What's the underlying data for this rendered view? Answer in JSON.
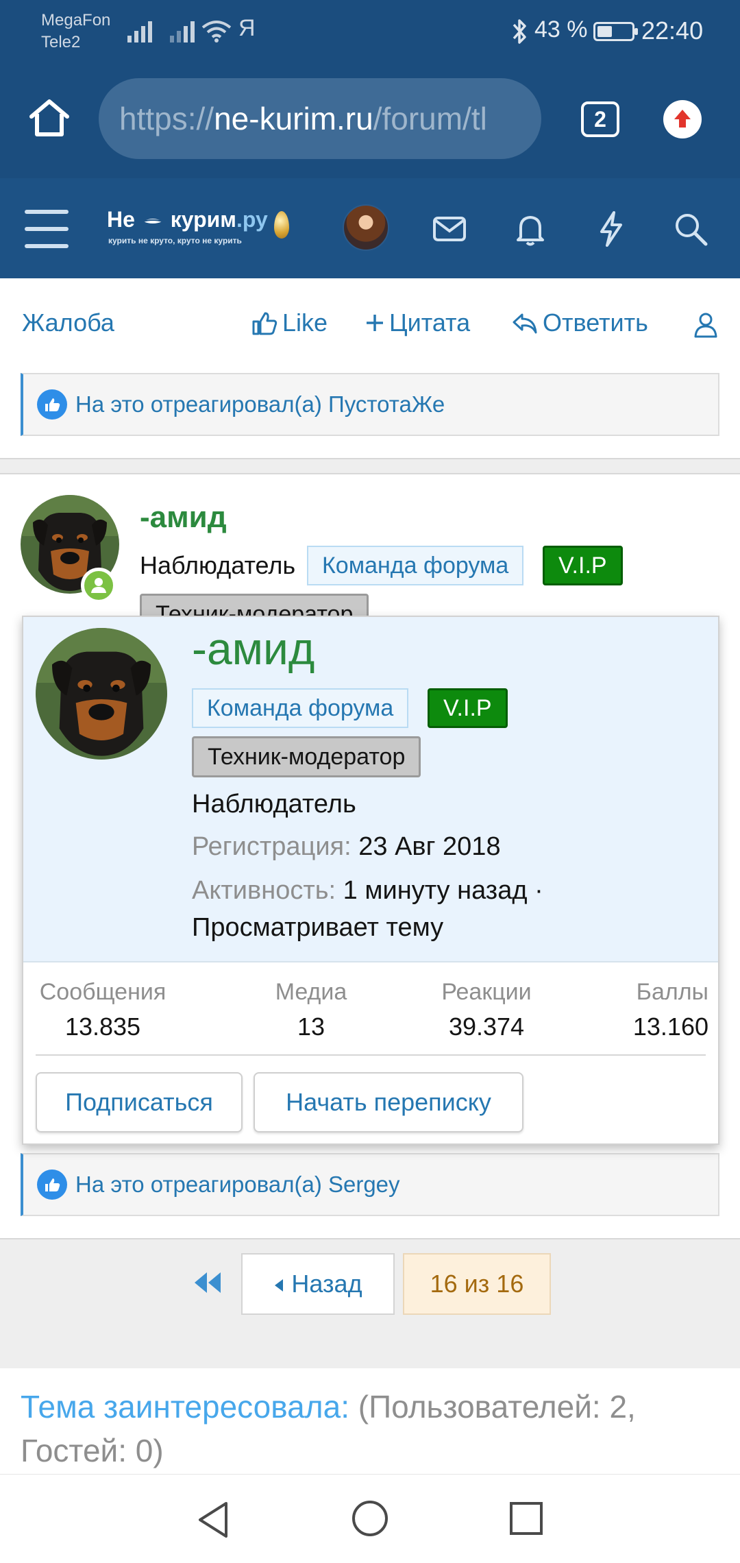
{
  "status_bar": {
    "carrier1": "MegaFon",
    "carrier2": "Tele2",
    "extra_icon": "Я",
    "battery_text": "43 %",
    "battery_level": 0.43,
    "time": "22:40"
  },
  "browser": {
    "url_scheme": "https://",
    "url_domain": "ne-kurim.ru",
    "url_path": "/forum/tl",
    "tab_count": "2"
  },
  "site_header": {
    "logo_left": "Не",
    "logo_right": "курим",
    "logo_tld": ".ру",
    "logo_tagline": "курить не круто, круто не курить"
  },
  "post_actions": {
    "report": "Жалоба",
    "like": "Like",
    "quote": "Цитата",
    "reply": "Ответить"
  },
  "reactions": {
    "first": "На это отреагировал(а) ПустотаЖе",
    "second": "На это отреагировал(а) Sergey"
  },
  "post": {
    "username": "-амид",
    "user_title": "Наблюдатель",
    "banner_team": "Команда форума",
    "banner_vip": "V.I.P",
    "banner_tech": "Техник-модератор"
  },
  "member_card": {
    "username": "-амид",
    "banner_team": "Команда форума",
    "banner_vip": "V.I.P",
    "banner_tech": "Техник-модератор",
    "user_title": "Наблюдатель",
    "registered_label": "Регистрация:",
    "registered_value": "23 Авг 2018",
    "activity_label": "Активность:",
    "activity_value": "1 минуту назад ·",
    "activity_detail": "Просматривает тему",
    "stats": [
      {
        "label": "Сообщения",
        "value": "13.835"
      },
      {
        "label": "Медиа",
        "value": "13"
      },
      {
        "label": "Реакции",
        "value": "39.374"
      },
      {
        "label": "Баллы",
        "value": "13.160"
      }
    ],
    "follow_button": "Подписаться",
    "conversation_button": "Начать переписку"
  },
  "pagination": {
    "back": "Назад",
    "position": "16 из 16"
  },
  "topic_info": {
    "label": "Тема заинтересовала:",
    "text": " (Пользователей: 2, Гостей: 0)"
  },
  "colors": {
    "header_bg": "#1d5285",
    "status_bg": "#1b4d7e",
    "link": "#2577b1",
    "username": "#2c8a3e",
    "vip_badge": "#0d8a0d",
    "card_bg": "#e9f3fd"
  },
  "icons": {
    "home": "home-icon",
    "tabs": "tabs-icon",
    "update": "update-arrow-icon",
    "menu": "hamburger-menu-icon",
    "inbox": "envelope-icon",
    "alerts": "bell-icon",
    "whats_new": "lightning-icon",
    "search": "search-icon",
    "like": "thumbs-up-icon",
    "quote": "plus-icon",
    "reply": "reply-arrow-icon",
    "user": "user-icon",
    "first_page": "double-chevron-left-icon",
    "back": "triangle-left-icon",
    "nav_back": "triangle-back-icon",
    "nav_home": "circle-home-icon",
    "nav_recents": "square-recents-icon"
  }
}
